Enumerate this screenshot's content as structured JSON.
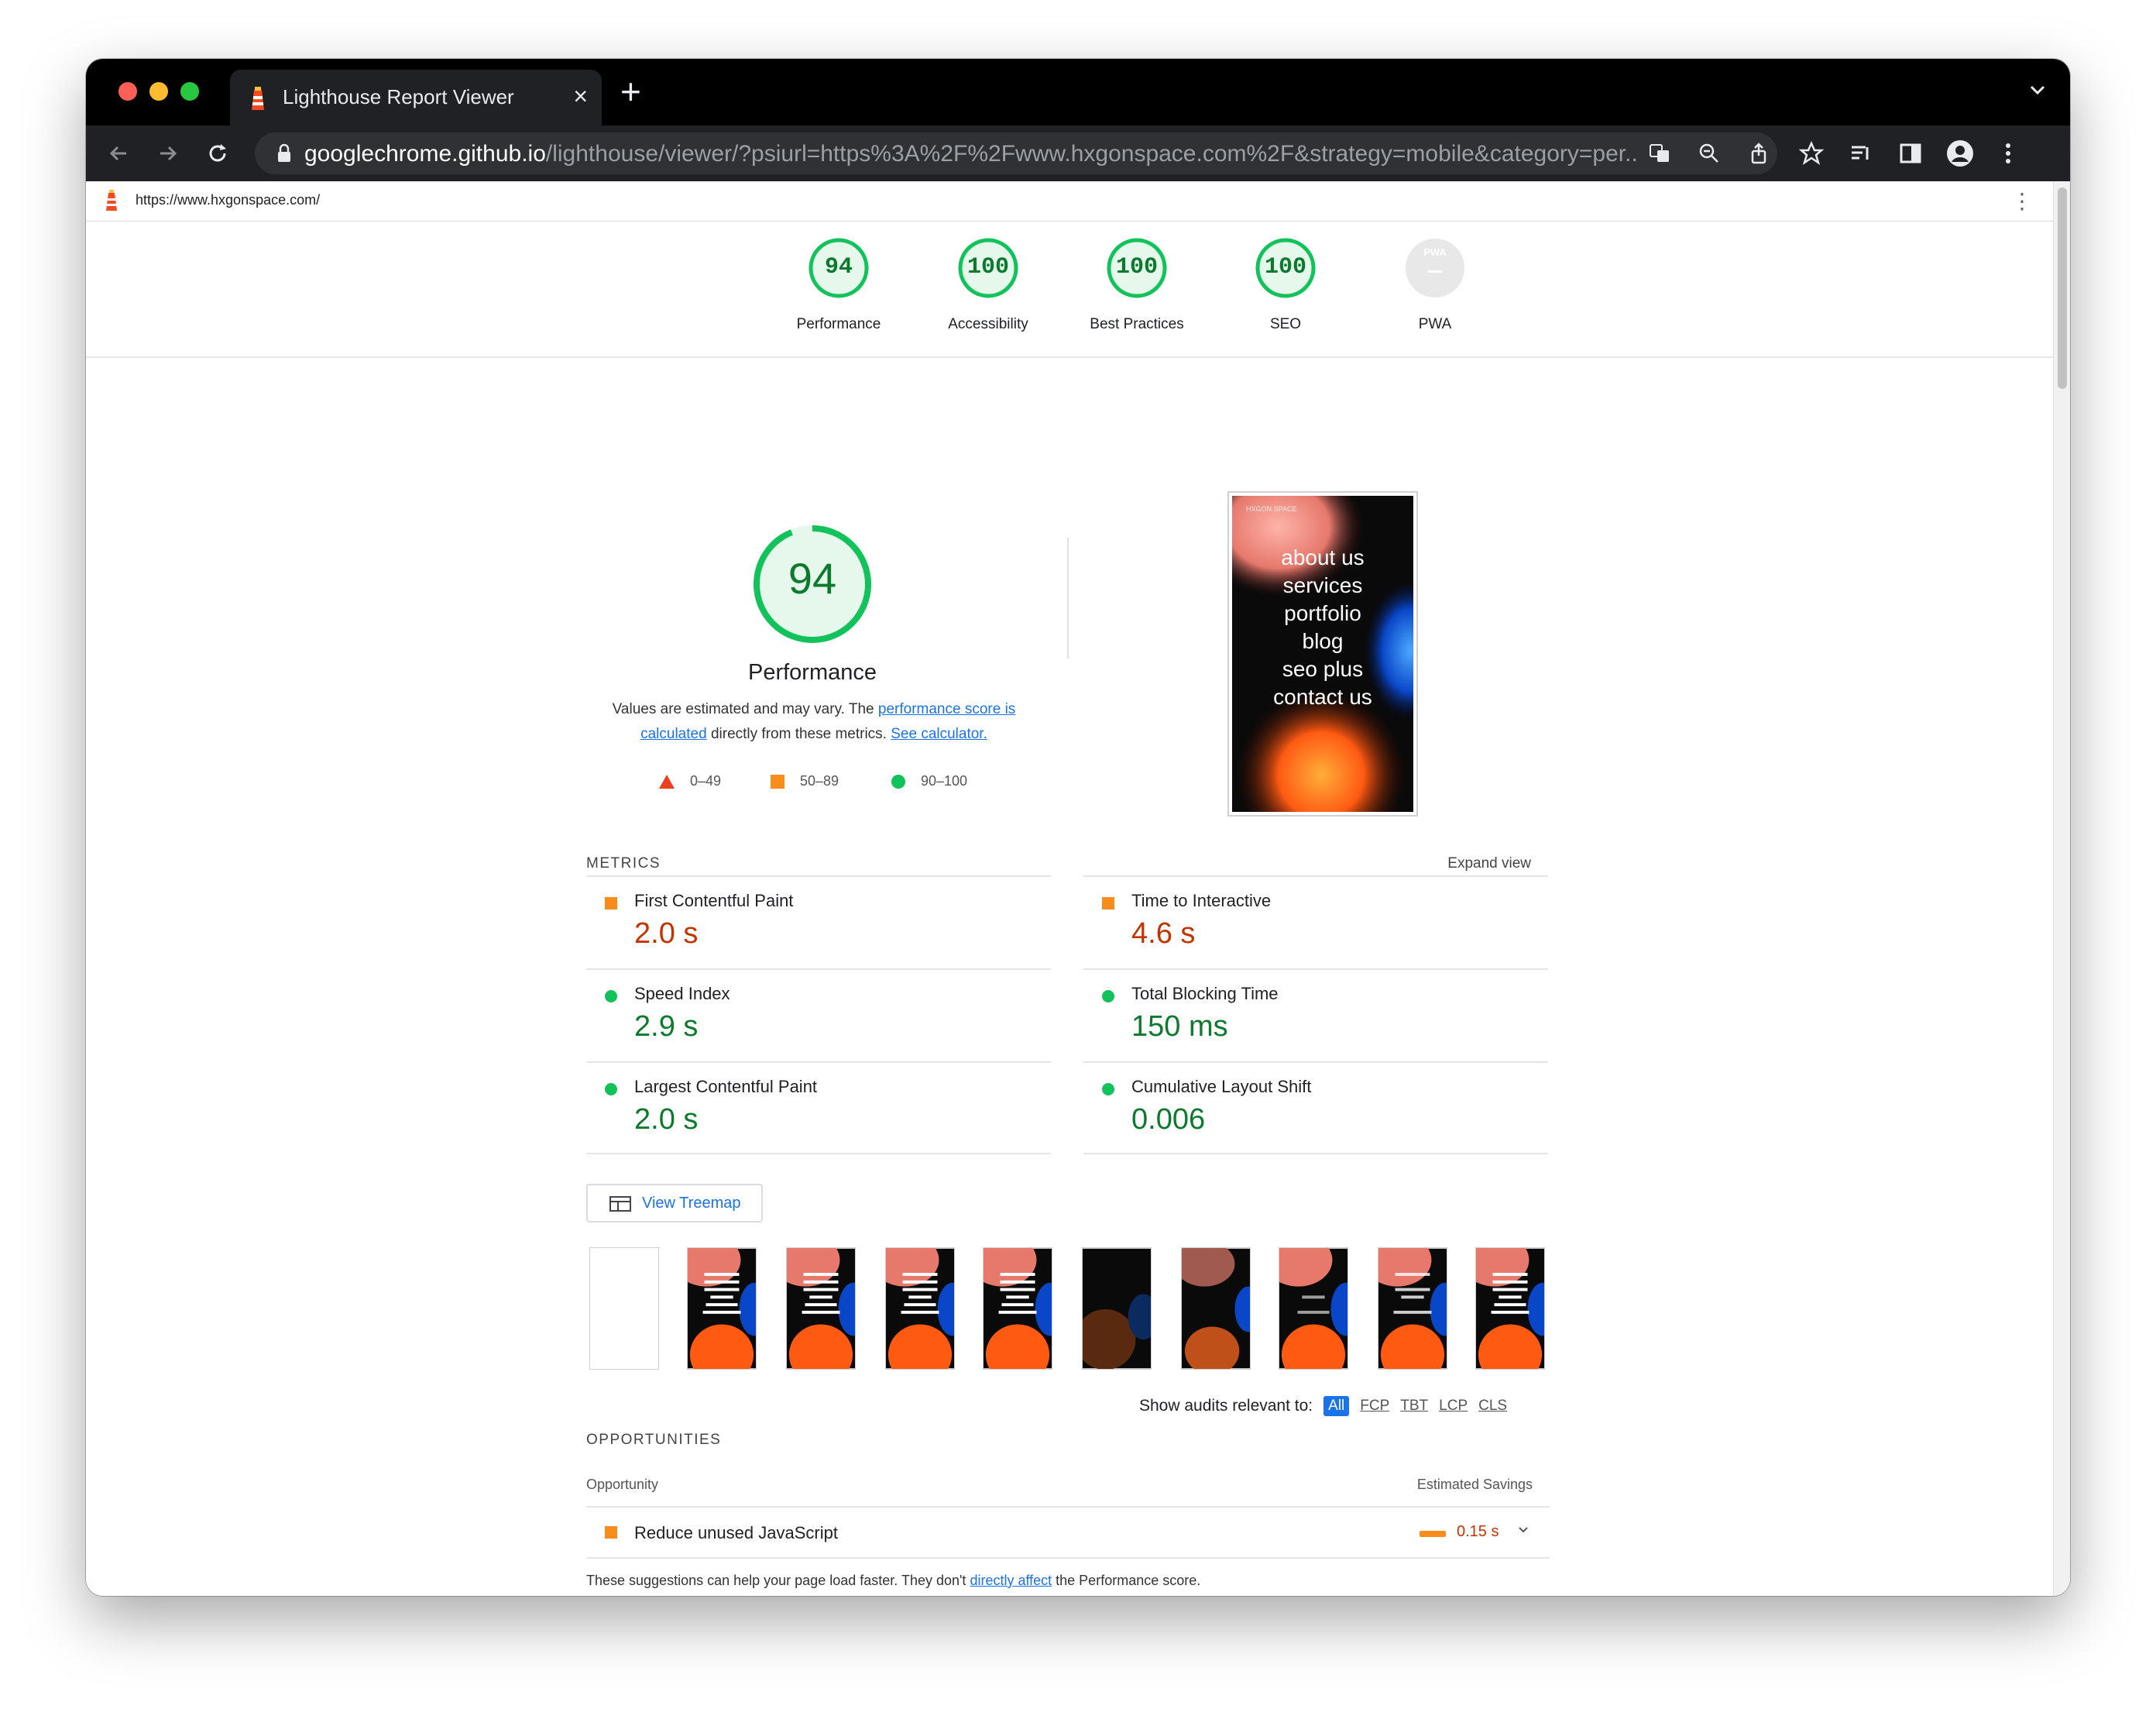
{
  "browser": {
    "tab_title": "Lighthouse Report Viewer",
    "tab_close": "×",
    "new_tab": "+",
    "url_host": "googlechrome.github.io",
    "url_rest": "/lighthouse/viewer/?psiurl=https%3A%2F%2Fwww.hxgonspace.com%2F&strategy=mobile&category=per..."
  },
  "report": {
    "page_url": "https://www.hxgonspace.com/",
    "menu_glyph": "⋮",
    "categories": [
      {
        "label": "Performance",
        "score": "94"
      },
      {
        "label": "Accessibility",
        "score": "100"
      },
      {
        "label": "Best Practices",
        "score": "100"
      },
      {
        "label": "SEO",
        "score": "100"
      },
      {
        "label": "PWA",
        "score": "—",
        "badge": "PWA"
      }
    ],
    "performance": {
      "score": "94",
      "label": "Performance",
      "desc_pre": "Values are estimated and may vary. The ",
      "desc_link1": "performance score is calculated",
      "desc_mid": " directly from these metrics. ",
      "desc_link2": "See calculator."
    },
    "legend": [
      {
        "range": "0–49",
        "color": "#eb3f22"
      },
      {
        "range": "50–89",
        "color": "#fa8c1c"
      },
      {
        "range": "90–100",
        "color": "#12c25a"
      }
    ],
    "screenshot": {
      "brand": "HXGON SPACE",
      "menu_items": [
        "about us",
        "services",
        "portfolio",
        "blog",
        "seo plus",
        "contact us"
      ]
    },
    "metrics_heading": "METRICS",
    "expand_view": "Expand view",
    "metrics_left": [
      {
        "title": "First Contentful Paint",
        "value": "2.0 s",
        "status": "average"
      },
      {
        "title": "Speed Index",
        "value": "2.9 s",
        "status": "pass"
      },
      {
        "title": "Largest Contentful Paint",
        "value": "2.0 s",
        "status": "pass"
      }
    ],
    "metrics_right": [
      {
        "title": "Time to Interactive",
        "value": "4.6 s",
        "status": "average"
      },
      {
        "title": "Total Blocking Time",
        "value": "150 ms",
        "status": "pass"
      },
      {
        "title": "Cumulative Layout Shift",
        "value": "0.006",
        "status": "pass"
      }
    ],
    "treemap_label": "View Treemap",
    "filter": {
      "label": "Show audits relevant to:",
      "chips": [
        "All",
        "FCP",
        "TBT",
        "LCP",
        "CLS"
      ],
      "active": "All"
    },
    "opportunities_heading": "OPPORTUNITIES",
    "opp_col_left": "Opportunity",
    "opp_col_right": "Estimated Savings",
    "opportunity": {
      "title": "Reduce unused JavaScript",
      "saving": "0.15 s"
    },
    "note_pre": "These suggestions can help your page load faster. They don't ",
    "note_link": "directly affect",
    "note_post": " the Performance score."
  },
  "colors": {
    "pass": "#0c7a2c",
    "pass_indicator": "#12c25a",
    "average": "#c33300",
    "average_indicator": "#fa8c1c",
    "link": "#1a73e8"
  }
}
